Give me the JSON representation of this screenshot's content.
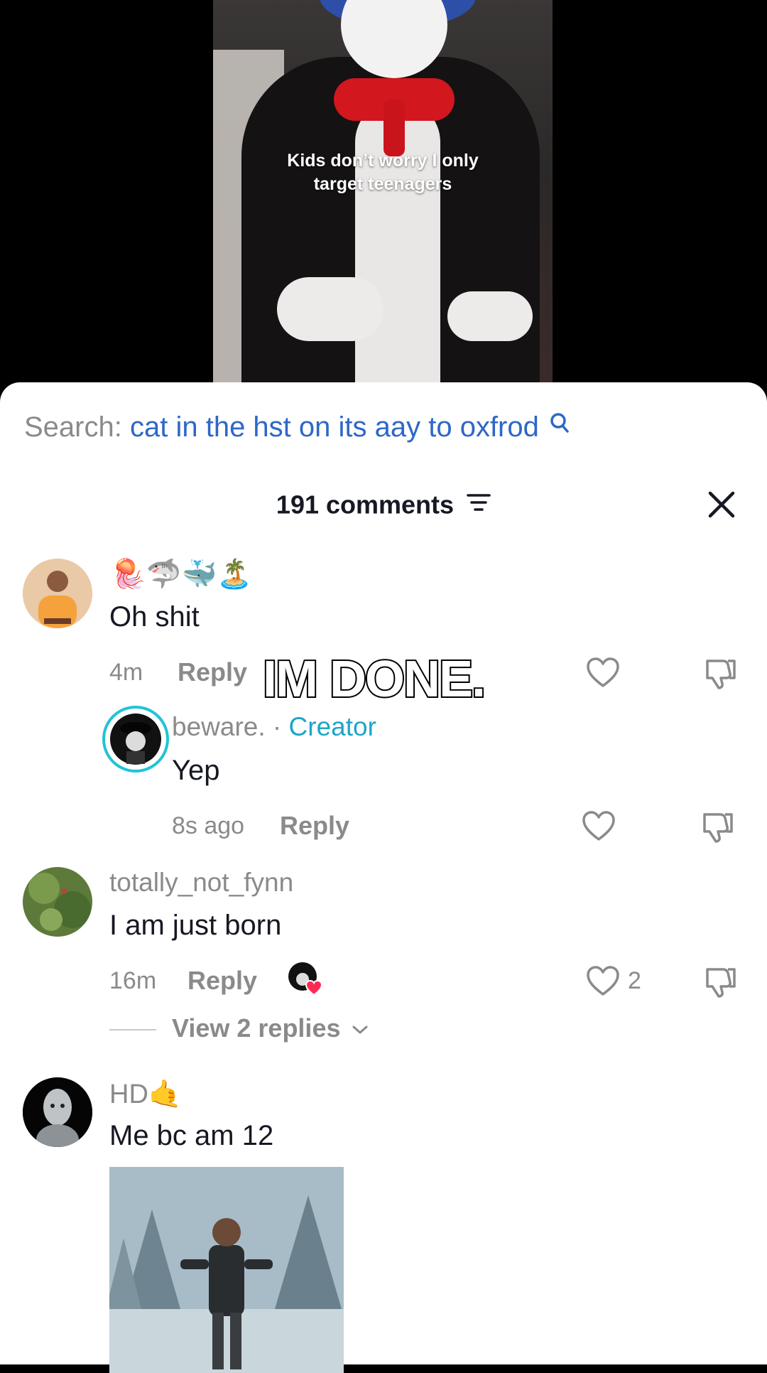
{
  "video": {
    "caption_line1": "Kids don’t worry I only",
    "caption_line2": "target teenagers"
  },
  "overlay": {
    "text": "IM DONE."
  },
  "search": {
    "label": "Search:",
    "query": "cat in the hst on its aay to oxfrod"
  },
  "header": {
    "comment_count": "191 comments"
  },
  "comments": [
    {
      "username_emoji": "🪼🦈🐳🏝️",
      "text": "Oh shit",
      "time": "4m",
      "reply_label": "Reply"
    },
    {
      "username": "beware.",
      "separator": "·",
      "badge": "Creator",
      "text": "Yep",
      "time": "8s ago",
      "reply_label": "Reply"
    },
    {
      "username": "totally_not_fynn",
      "text": "I am just born",
      "time": "16m",
      "reply_label": "Reply",
      "likes": "2",
      "view_replies": "View 2 replies"
    },
    {
      "username": "HD🤙",
      "text": "Me bc am 12"
    }
  ]
}
